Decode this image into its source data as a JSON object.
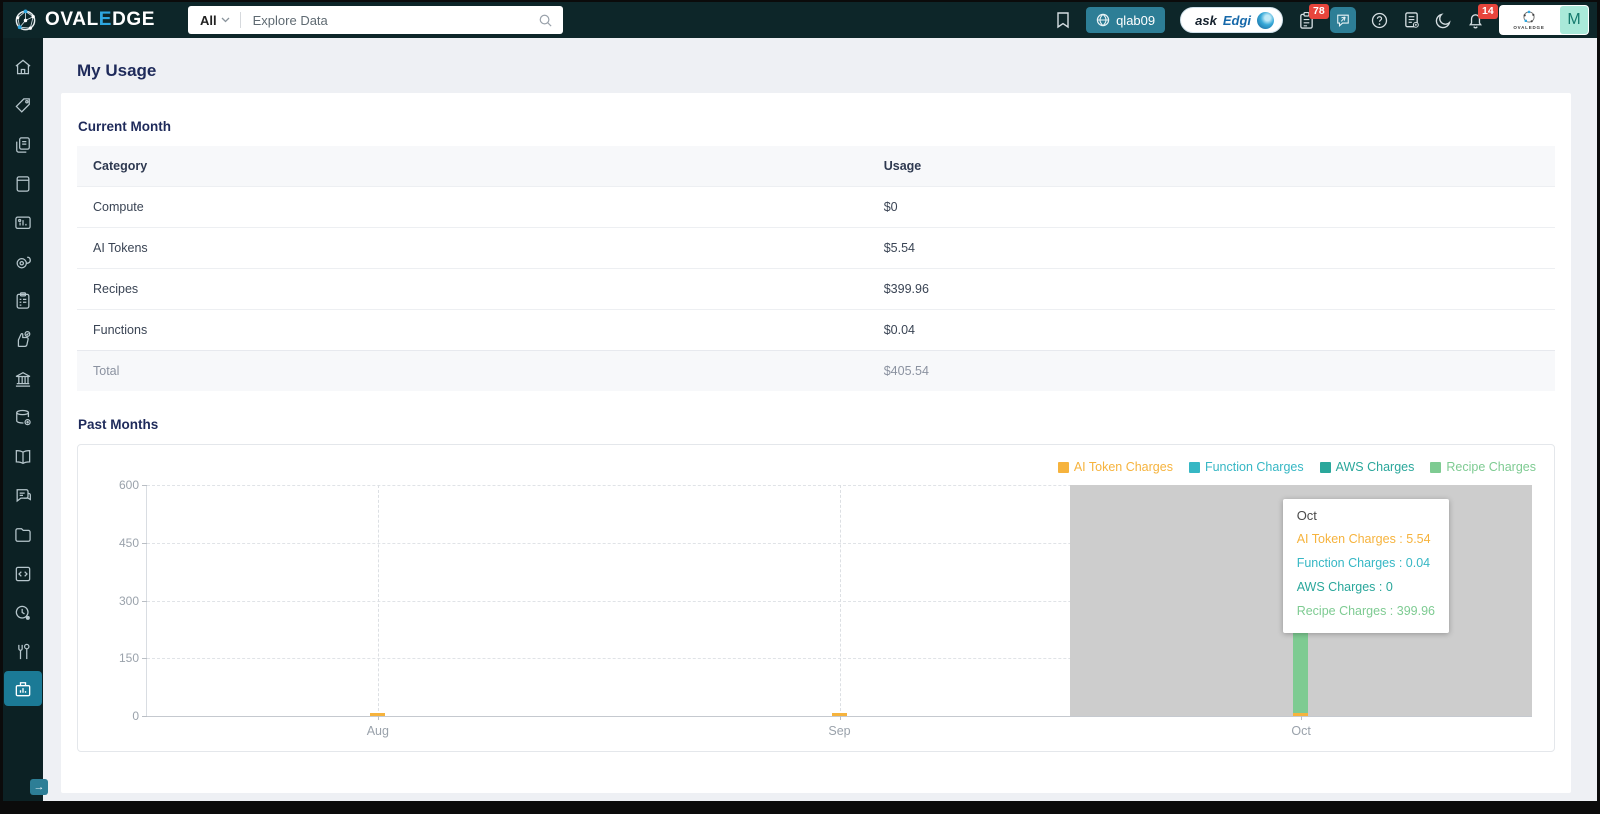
{
  "topbar": {
    "brand": {
      "part1": "OVAL",
      "accent": "E",
      "part2": "DGE"
    },
    "search": {
      "scope": "All",
      "placeholder": "Explore Data"
    },
    "env_button": "qlab09",
    "askedgi": {
      "part1": "ask",
      "part2": "Edgi"
    },
    "clipboard_badge": "78",
    "bell_badge": "14",
    "profile": {
      "brand_mini": "OVALEDGE",
      "avatar_letter": "M"
    },
    "icons": [
      "bookmark",
      "globe",
      "clipboard-tasks",
      "chat-translate",
      "help",
      "release-notes",
      "dark-mode",
      "notifications"
    ]
  },
  "sidebar": {
    "active": "usage-dashboard",
    "items": [
      "home",
      "tags",
      "certifications",
      "catalog",
      "reports",
      "lineage",
      "checklist",
      "approvals",
      "governance",
      "data-stores",
      "business-glossary",
      "collaboration",
      "projects",
      "query-sheet",
      "jobs",
      "tools",
      "usage-dashboard"
    ]
  },
  "page": {
    "title": "My Usage"
  },
  "current_month": {
    "heading": "Current Month",
    "columns": [
      "Category",
      "Usage"
    ],
    "rows": [
      [
        "Compute",
        "$0"
      ],
      [
        "AI Tokens",
        "$5.54"
      ],
      [
        "Recipes",
        "$399.96"
      ],
      [
        "Functions",
        "$0.04"
      ]
    ],
    "total_label": "Total",
    "total_value": "$405.54"
  },
  "past_months": {
    "heading": "Past Months"
  },
  "chart_data": {
    "type": "bar",
    "title": "Past Months",
    "xlabel": "",
    "ylabel": "",
    "categories": [
      "Aug",
      "Sep",
      "Oct"
    ],
    "series": [
      {
        "name": "AI Token Charges",
        "color": "#F6B33D",
        "values": [
          5,
          5,
          5.54
        ]
      },
      {
        "name": "Function Charges",
        "color": "#36B7C4",
        "values": [
          0,
          0,
          0.04
        ]
      },
      {
        "name": "AWS Charges",
        "color": "#2AA79B",
        "values": [
          0,
          0,
          0
        ]
      },
      {
        "name": "Recipe Charges",
        "color": "#7ECB92",
        "values": [
          0,
          0,
          399.96
        ]
      }
    ],
    "ylim": [
      0,
      600
    ],
    "yticks": [
      0,
      150,
      300,
      450,
      600
    ],
    "grid": "dashed",
    "legend_position": "top-right",
    "highlighted_category": "Oct",
    "tooltip": {
      "title": "Oct",
      "lines": [
        {
          "label": "AI Token Charges",
          "value": "5.54",
          "color": "#F6B33D"
        },
        {
          "label": "Function Charges",
          "value": "0.04",
          "color": "#36B7C4"
        },
        {
          "label": "AWS Charges",
          "value": "0",
          "color": "#2AA79B"
        },
        {
          "label": "Recipe Charges",
          "value": "399.96",
          "color": "#7ECB92"
        }
      ]
    }
  },
  "colors": {
    "navbar_bg": "#0d2629",
    "sidebar_bg": "#0c2124",
    "accent_teal": "#2d7e96",
    "badge_red": "#e8453c",
    "heading_navy": "#1e2a5a",
    "avatar_mint": "#a9e9d9",
    "hover_band_gray": "#cdcdcd"
  }
}
